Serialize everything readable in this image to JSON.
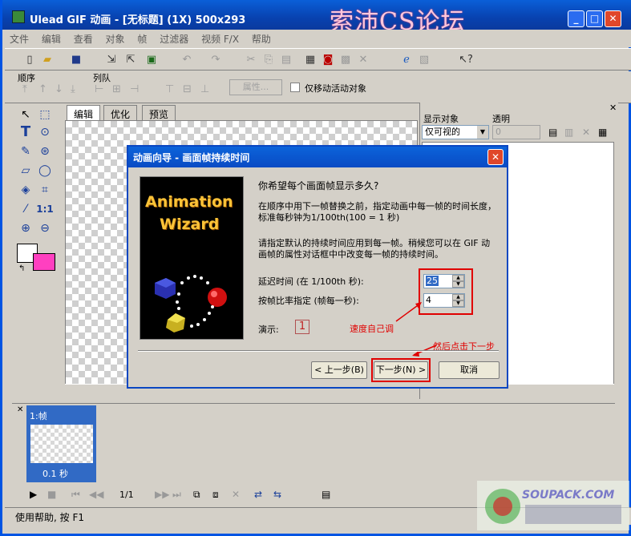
{
  "window": {
    "title": "Ulead GIF 动画 - [无标题] (1X) 500x293",
    "watermark": "索沛CS论坛",
    "caption_buttons": [
      "minimize",
      "maximize",
      "close"
    ]
  },
  "menu": [
    "文件",
    "编辑",
    "查看",
    "对象",
    "帧",
    "过滤器",
    "视频 F/X",
    "帮助"
  ],
  "toolbar_icons": [
    "new-icon",
    "open-icon",
    "save-icon",
    "import-icon",
    "export-icon",
    "wizard-icon",
    "undo-icon",
    "redo-icon",
    "cut-icon",
    "copy-icon",
    "paste-icon"
  ],
  "secbar": {
    "order_label": "顺序",
    "align_label": "列队",
    "properties_button": "属性...",
    "move_active_label": "仅移动活动对象"
  },
  "tabs": [
    "编辑",
    "优化",
    "预览"
  ],
  "right_panel": {
    "display_label": "显示对象",
    "opacity_label": "透明",
    "display_value": "仅可视的",
    "opacity_value": "0"
  },
  "frames": [
    {
      "label": "1:帧",
      "time": "0.1 秒"
    }
  ],
  "playback": {
    "page": "1/1"
  },
  "status": "使用帮助, 按 F1",
  "dialog": {
    "title": "动画向导 - 画面帧持续时间",
    "wizard_line1": "Animation",
    "wizard_line2": "Wizard",
    "question": "你希望每个画面帧显示多久?",
    "para1": "在顺序中用下一帧替换之前，指定动画中每一帧的时间长度，标准每秒钟为1/100th(100 = 1 秒)",
    "para2": "请指定默认的持续时间应用到每一帧。稍候您可以在 GIF 动画帧的属性对话框中中改变每一帧的持续时间。",
    "delay_label": "延迟时间 (在 1/100th 秒):",
    "delay_value": "25",
    "fps_label": "按帧比率指定 (帧每一秒):",
    "fps_value": "4",
    "demo_label": "演示:",
    "demo_value": "1",
    "annotation_speed": "速度自己调",
    "annotation_next": "然后点击下一步",
    "back_button": "< 上一步(B)",
    "next_button": "下一步(N) >",
    "cancel_button": "取消"
  },
  "logo_text": "SOUPACK.COM",
  "colors": {
    "titlebar": "#0a4bc4",
    "face": "#d4d0c8",
    "selected_frame": "#316ac5",
    "annotation_red": "#e00000",
    "wizard_gold": "#fbc338",
    "bg_color_swatch": "#ff40c0"
  }
}
